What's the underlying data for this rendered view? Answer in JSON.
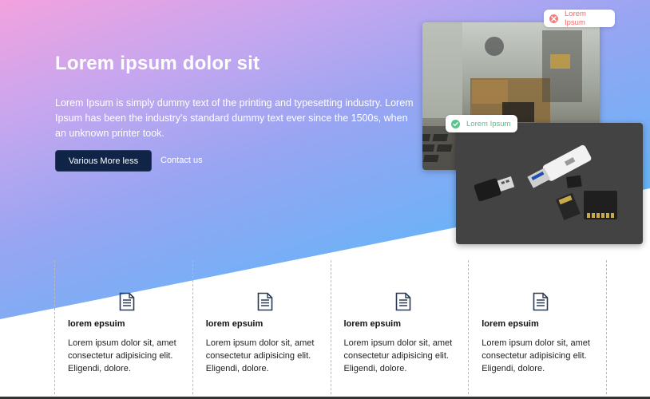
{
  "hero": {
    "title": "Lorem ipsum dolor sit",
    "description": "Lorem Ipsum is simply dummy text of the printing and typesetting industry. Lorem Ipsum has been the industry's standard dummy text ever since the 1500s, when an unknown printer took.",
    "primary_button": "Various More less",
    "secondary_link": "Contact us"
  },
  "badges": {
    "error": {
      "label": "Lorem Ipsum",
      "icon": "close-icon",
      "color": "#f06b6b"
    },
    "success": {
      "label": "Lorem Ipsum",
      "icon": "check-icon",
      "color": "#55c08d"
    }
  },
  "images": {
    "back": "desk-photo",
    "front": "usb-sd-cards-photo"
  },
  "features": [
    {
      "icon": "document-icon",
      "title": "lorem epsuim",
      "text": "Lorem ipsum dolor sit, amet consectetur adipisicing elit. Eligendi, dolore."
    },
    {
      "icon": "document-icon",
      "title": "lorem epsuim",
      "text": "Lorem ipsum dolor sit, amet consectetur adipisicing elit. Eligendi, dolore."
    },
    {
      "icon": "document-icon",
      "title": "lorem epsuim",
      "text": "Lorem ipsum dolor sit, amet consectetur adipisicing elit. Eligendi, dolore."
    },
    {
      "icon": "document-icon",
      "title": "lorem epsuim",
      "text": "Lorem ipsum dolor sit, amet consectetur adipisicing elit. Eligendi, dolore."
    }
  ],
  "colors": {
    "button_bg": "#0f2447",
    "gradient_start": "#f3a2de",
    "gradient_end": "#37c6fb"
  }
}
